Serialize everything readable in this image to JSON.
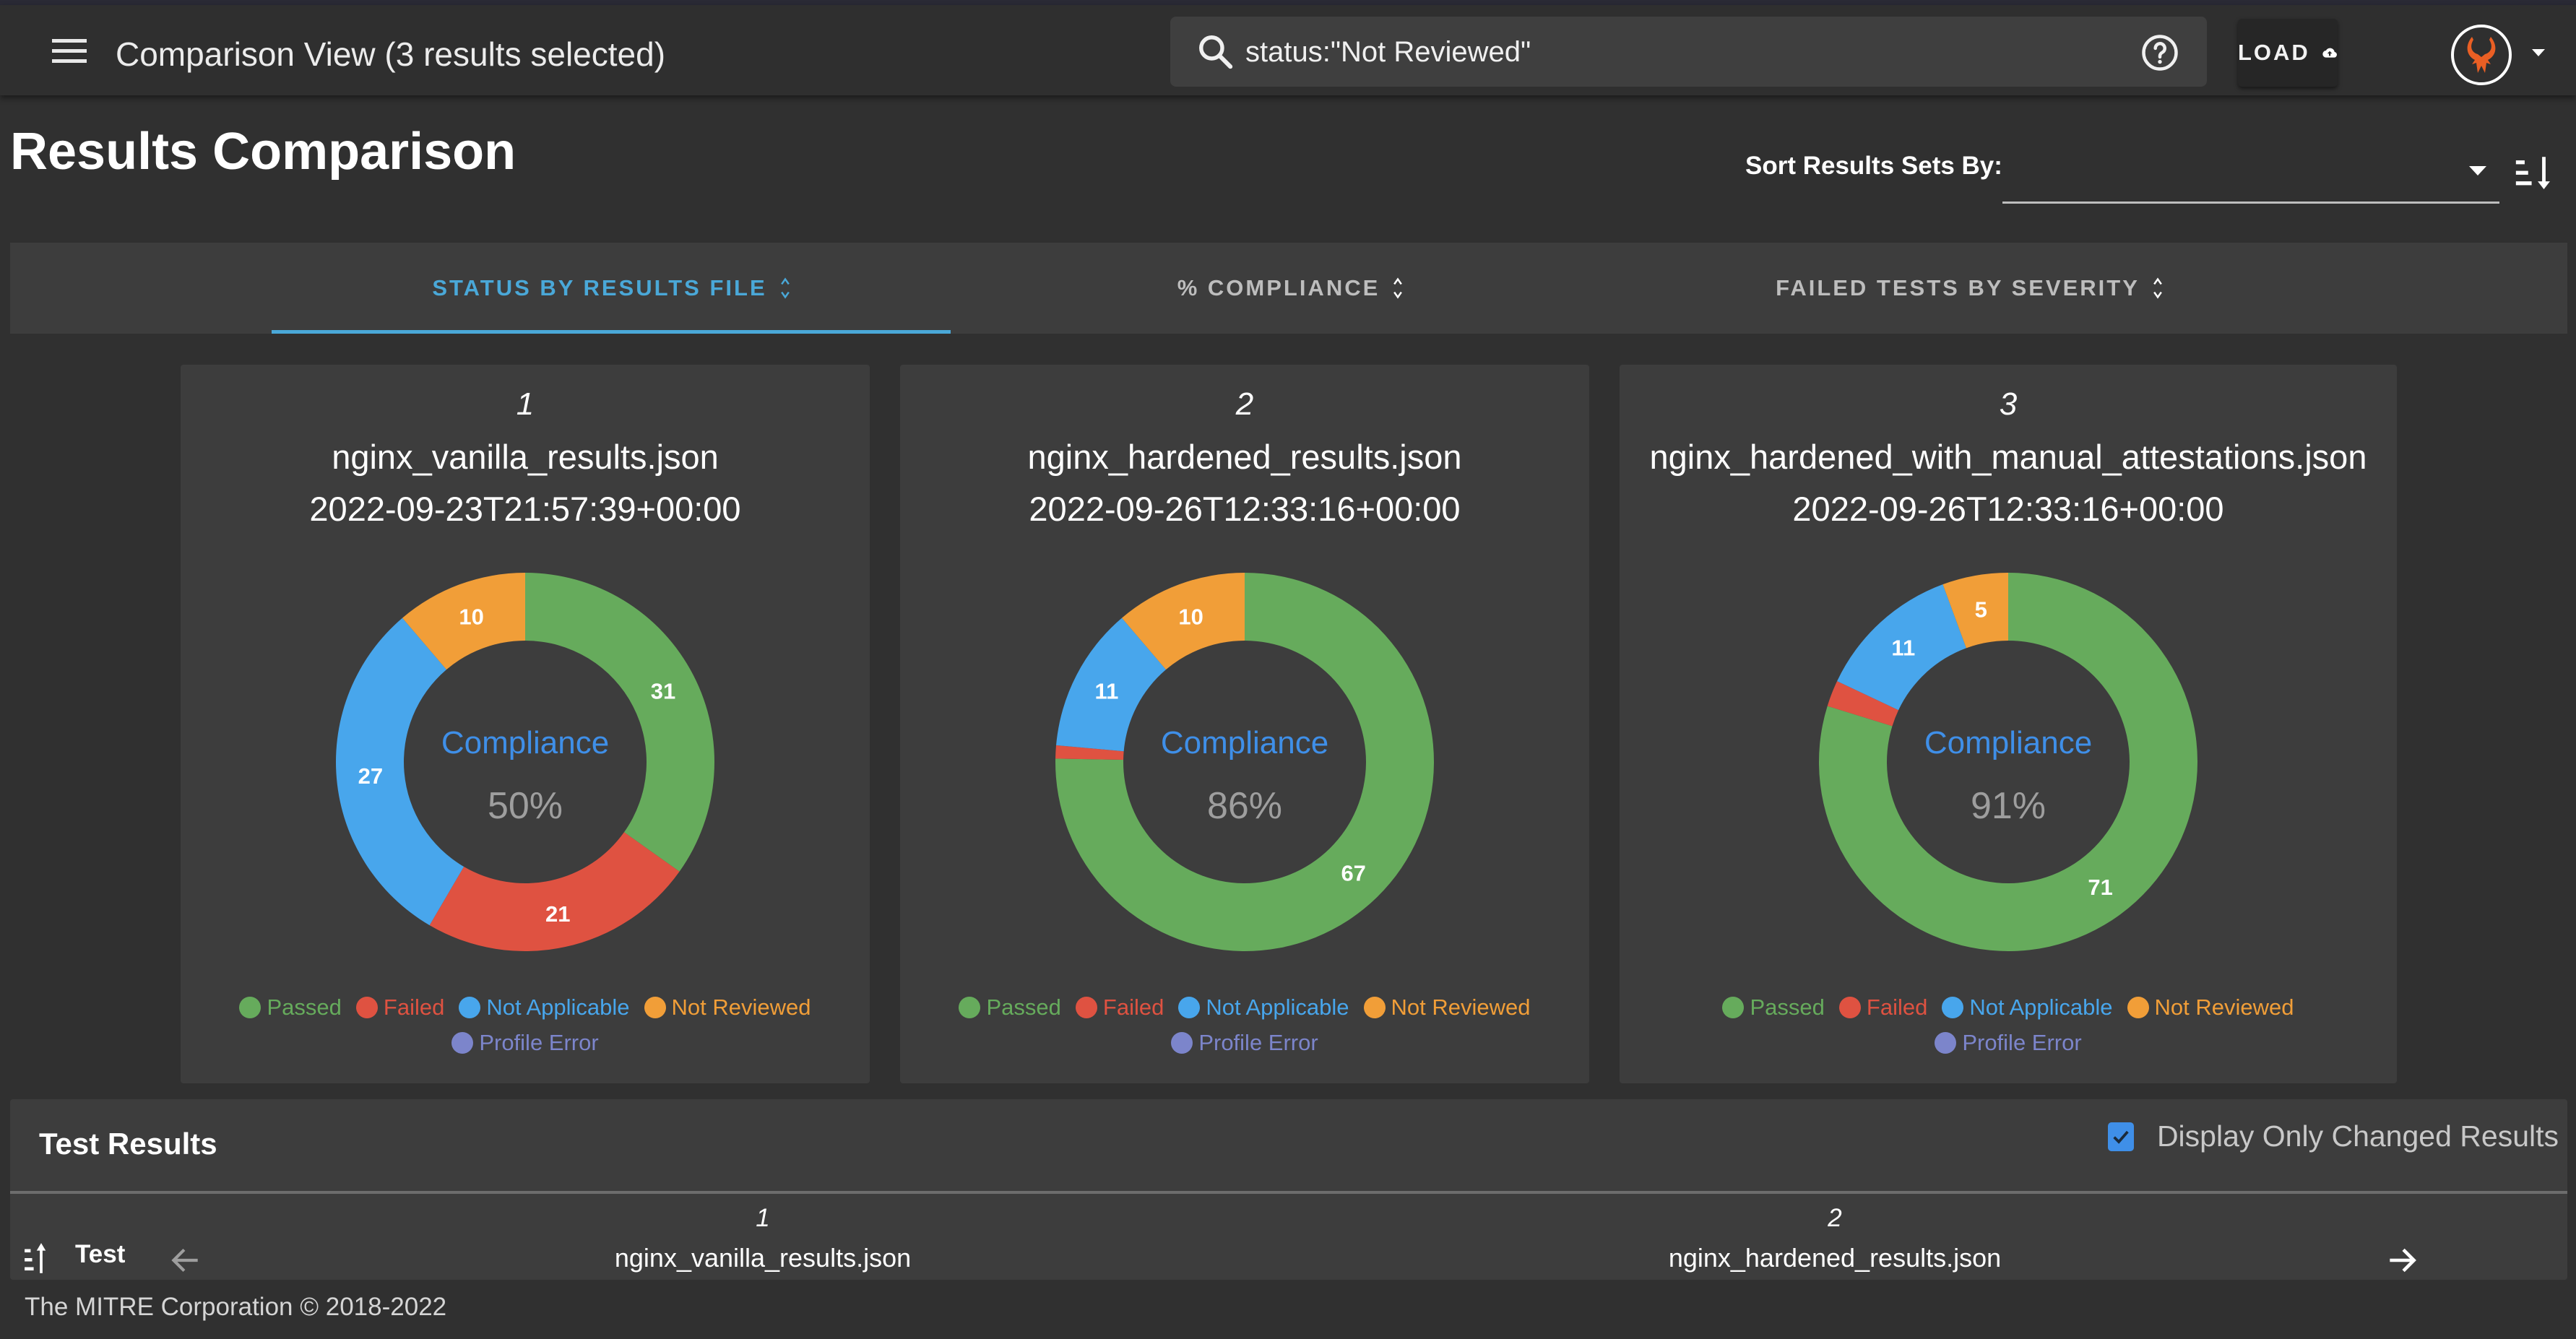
{
  "appbar": {
    "title": "Comparison View (3 results selected)",
    "search_value": "status:\"Not Reviewed\"",
    "load_label": "LOAD"
  },
  "page": {
    "title": "Results Comparison",
    "sort_label": "Sort Results Sets By:",
    "sort_value": ""
  },
  "tabs": [
    {
      "label": "STATUS BY RESULTS FILE",
      "active": true
    },
    {
      "label": "% COMPLIANCE",
      "active": false
    },
    {
      "label": "FAILED TESTS BY SEVERITY",
      "active": false
    }
  ],
  "colors": {
    "passed": "#66ab5c",
    "failed": "#df5241",
    "not_applicable": "#48a6ec",
    "not_reviewed": "#f19e38",
    "profile_error": "#7c85cb",
    "accent": "#4aa8d8",
    "compliance_label": "#3f8fe8",
    "compliance_value": "#9e9e9e"
  },
  "legend": [
    "Passed",
    "Failed",
    "Not Applicable",
    "Not Reviewed",
    "Profile Error"
  ],
  "chart_data": [
    {
      "type": "pie",
      "index": "1",
      "title": "nginx_vanilla_results.json",
      "subtitle": "2022-09-23T21:57:39+00:00",
      "center_label": "Compliance",
      "center_value": "50%",
      "categories": [
        "Passed",
        "Failed",
        "Not Applicable",
        "Not Reviewed",
        "Profile Error"
      ],
      "values": [
        31,
        21,
        27,
        10,
        0
      ],
      "labels": [
        "31",
        "21",
        "27",
        "10",
        ""
      ]
    },
    {
      "type": "pie",
      "index": "2",
      "title": "nginx_hardened_results.json",
      "subtitle": "2022-09-26T12:33:16+00:00",
      "center_label": "Compliance",
      "center_value": "86%",
      "categories": [
        "Passed",
        "Failed",
        "Not Applicable",
        "Not Reviewed",
        "Profile Error"
      ],
      "values": [
        67,
        1,
        11,
        10,
        0
      ],
      "labels": [
        "67",
        "",
        "11",
        "10",
        ""
      ]
    },
    {
      "type": "pie",
      "index": "3",
      "title": "nginx_hardened_with_manual_attestations.json",
      "subtitle": "2022-09-26T12:33:16+00:00",
      "center_label": "Compliance",
      "center_value": "91%",
      "categories": [
        "Passed",
        "Failed",
        "Not Applicable",
        "Not Reviewed",
        "Profile Error"
      ],
      "values": [
        71,
        2,
        11,
        5,
        0
      ],
      "labels": [
        "71",
        "",
        "11",
        "5",
        ""
      ]
    }
  ],
  "test_results": {
    "title": "Test Results",
    "changed_only_label": "Display Only Changed Results",
    "changed_only_checked": true,
    "test_column_label": "Test",
    "columns": [
      {
        "index": "1",
        "file": "nginx_vanilla_results.json"
      },
      {
        "index": "2",
        "file": "nginx_hardened_results.json"
      }
    ]
  },
  "footer": {
    "text": "The MITRE Corporation © 2018-2022"
  }
}
